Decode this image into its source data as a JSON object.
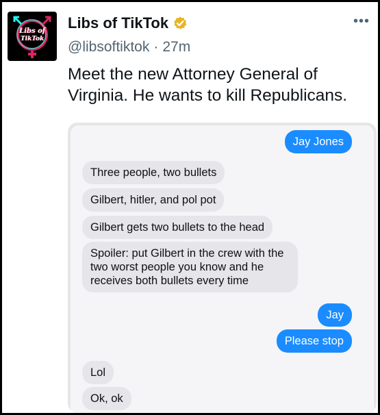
{
  "tweet": {
    "display_name": "Libs of TikTok",
    "handle": "@libsoftiktok",
    "separator": "·",
    "time": "27m",
    "text": "Meet the new Attorney General of Virginia. He wants to kill Republicans.",
    "avatar_lines": [
      "Libs of",
      "TikTok"
    ],
    "more_icon": "more-horizontal-icon",
    "verified_icon": "verified-badge-icon",
    "colors": {
      "verified_badge": "#e8b524",
      "text_primary": "#0f1419",
      "text_secondary": "#536471",
      "avatar_accent": "#e0245e",
      "avatar_accent2": "#25f4ee"
    }
  },
  "chat": {
    "colors": {
      "incoming": "#e5e5ea",
      "outgoing": "#1a8cff",
      "background": "#f5f5f7"
    },
    "messages": [
      {
        "direction": "outgoing",
        "text": "Jay Jones"
      },
      {
        "direction": "incoming",
        "text": "Three people, two bullets"
      },
      {
        "direction": "incoming",
        "text": "Gilbert, hitler, and pol pot"
      },
      {
        "direction": "incoming",
        "text": "Gilbert gets two bullets to the head"
      },
      {
        "direction": "incoming",
        "text": "Spoiler: put Gilbert in the crew with the two worst people you know and he receives both bullets every time"
      },
      {
        "direction": "outgoing",
        "text": "Jay"
      },
      {
        "direction": "outgoing",
        "text": "Please stop"
      },
      {
        "direction": "incoming",
        "text": "Lol"
      },
      {
        "direction": "incoming",
        "text": "Ok, ok"
      }
    ]
  }
}
